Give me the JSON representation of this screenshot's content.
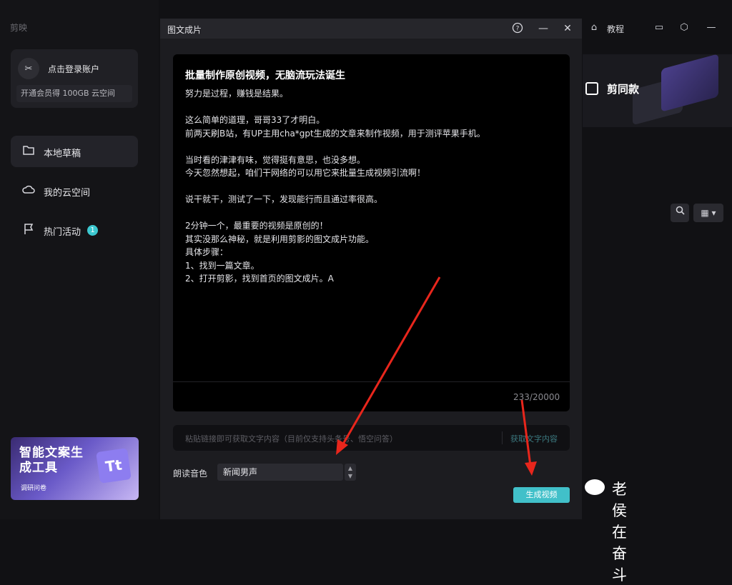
{
  "app": {
    "logo_text": "剪映"
  },
  "sidebar": {
    "login": {
      "label": "点击登录账户",
      "vip_text": "开通会员得 100GB 云空间"
    },
    "items": [
      {
        "label": "本地草稿",
        "icon": "folder-icon"
      },
      {
        "label": "我的云空间",
        "icon": "cloud-icon"
      },
      {
        "label": "热门活动",
        "icon": "flag-icon",
        "badge": "1"
      }
    ],
    "promo": {
      "title": "智能文案生成工具",
      "subtitle": "调研问卷",
      "glyph": "Tt"
    }
  },
  "top_right": {
    "tutorial": "教程"
  },
  "banner": {
    "label": "剪同款"
  },
  "dialog": {
    "title": "图文成片",
    "editor": {
      "title": "批量制作原创视频，无脑流玩法诞生",
      "body": "努力是过程，赚钱是结果。\n\n这么简单的道理，哥哥33了才明白。\n前两天刷B站，有UP主用cha*gpt生成的文章来制作视频，用于测评苹果手机。\n\n当时看的津津有味，觉得挺有意思，也没多想。\n今天忽然想起，咱们干网络的可以用它来批量生成视频引流啊！\n\n说干就干，测试了一下，发现能行而且通过率很高。\n\n2分钟一个，最重要的视频是原创的！\n其实没那么神秘，就是利用剪影的图文成片功能。\n具体步骤：\n1、找到一篇文章。\n2、打开剪影，找到首页的图文成片。A",
      "counter": "233/20000"
    },
    "url_input": {
      "placeholder": "粘贴链接即可获取文字内容（目前仅支持头条号、悟空问答）",
      "fetch_label": "获取文字内容"
    },
    "voice": {
      "label": "朗读音色",
      "value": "新闻男声"
    },
    "generate_label": "生成视频"
  },
  "watermark": {
    "text": "老侯在奋斗"
  },
  "colors": {
    "accent": "#41c0c9",
    "arrow": "#e8261c"
  }
}
